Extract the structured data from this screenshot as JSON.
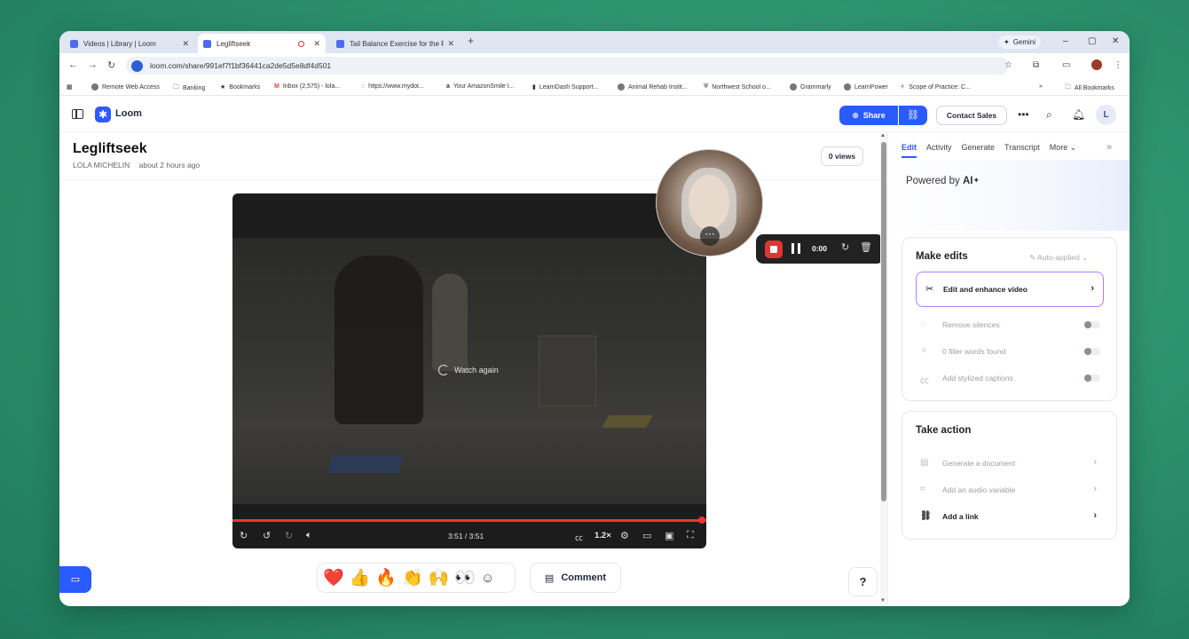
{
  "browser": {
    "tabs": [
      {
        "title": "Videos | Library | Loom"
      },
      {
        "title": "Legliftseek"
      },
      {
        "title": "Tail Balance Exercise for the Ro"
      }
    ],
    "gemini_label": "Gemini",
    "url": "loom.com/share/991ef7f1bf36441ca2de5d5e8df4d501",
    "bookmarks": [
      "Remote Web Access",
      "Banking",
      "Bookmarks",
      "Inbox (2,575) - lola...",
      "https://www.mydot...",
      "Your AmazonSmile I...",
      "LearnDash Support...",
      "Animal Rehab Instit...",
      "Northwest School o...",
      "Grammarly",
      "LearnPower",
      "Scope of Practice: C..."
    ],
    "all_bookmarks": "All Bookmarks"
  },
  "loom": {
    "brand": "Loom",
    "share_label": "Share",
    "contact_sales": "Contact Sales",
    "user_initial": "L"
  },
  "video": {
    "title": "Legliftseek",
    "author": "LOLA MICHELIN",
    "time_ago": "about 2 hours ago",
    "views": "0 views",
    "watch_again": "Watch again",
    "timecode": "3:51 / 3:51",
    "speed": "1.2×",
    "progress": 1.0
  },
  "recorder": {
    "elapsed": "0:00"
  },
  "reactions": [
    "❤️",
    "👍",
    "🔥",
    "👏",
    "🙌",
    "👀"
  ],
  "comment_label": "Comment",
  "help_label": "?",
  "panel": {
    "tabs": [
      "Edit",
      "Activity",
      "Generate",
      "Transcript",
      "More"
    ],
    "powered_prefix": "Powered by",
    "powered_ai": "AI",
    "make_edits": {
      "heading": "Make edits",
      "auto": "Auto-applied",
      "enhance": "Edit and enhance video",
      "options": [
        "Remove silences",
        "0 filler words found",
        "Add stylized captions"
      ]
    },
    "take_action": {
      "heading": "Take action",
      "items": [
        "Generate a document",
        "Add an audio variable",
        "Add a link"
      ]
    }
  }
}
